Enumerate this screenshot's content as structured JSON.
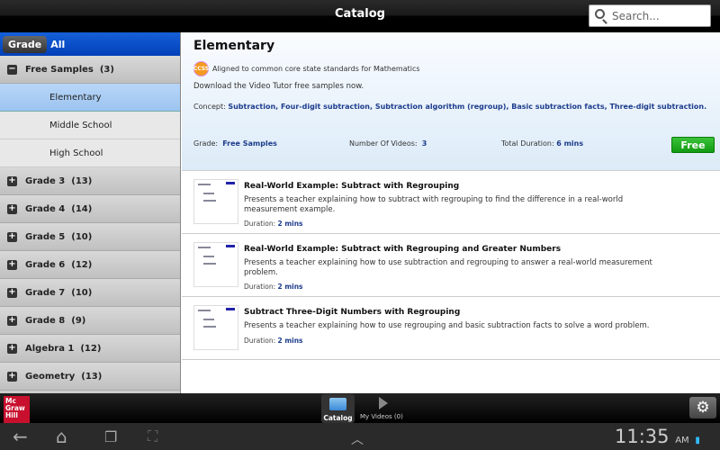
{
  "header": {
    "title": "Catalog",
    "search_placeholder": "Search..."
  },
  "sidebar": {
    "filter": {
      "button": "Grade",
      "value": "All"
    },
    "groups": [
      {
        "label": "Free Samples",
        "count": "(3)",
        "expanded": true,
        "children": [
          "Elementary",
          "Middle School",
          "High School"
        ],
        "selected": "Elementary"
      },
      {
        "label": "Grade 3",
        "count": "(13)"
      },
      {
        "label": "Grade 4",
        "count": "(14)"
      },
      {
        "label": "Grade 5",
        "count": "(10)"
      },
      {
        "label": "Grade 6",
        "count": "(12)"
      },
      {
        "label": "Grade 7",
        "count": "(10)"
      },
      {
        "label": "Grade 8",
        "count": "(9)"
      },
      {
        "label": "Algebra 1",
        "count": "(12)"
      },
      {
        "label": "Geometry",
        "count": "(13)"
      }
    ]
  },
  "detail": {
    "title": "Elementary",
    "ccss_badge": "CCSS",
    "ccss_text": "Aligned to common core state standards for Mathematics",
    "description": "Download the Video Tutor free samples now.",
    "concept_label": "Concept:",
    "concepts": "Subtraction, Four-digit subtraction, Subtraction algorithm (regroup), Basic subtraction facts, Three-digit subtraction.",
    "grade_label": "Grade:",
    "grade": "Free Samples",
    "videos_label": "Number Of Videos:",
    "videos": "3",
    "duration_label": "Total Duration:",
    "duration": "6 mins",
    "price_button": "Free"
  },
  "videos": [
    {
      "title": "Real-World Example: Subtract with Regrouping",
      "description": "Presents a teacher explaining how to subtract with regrouping to find the difference in a real-world measurement example.",
      "duration_label": "Duration:",
      "duration": "2 mins"
    },
    {
      "title": "Real-World Example: Subtract with Regrouping and Greater Numbers",
      "description": "Presents a teacher explaining how to use subtraction and regrouping to answer a real-world measurement problem.",
      "duration_label": "Duration:",
      "duration": "2 mins"
    },
    {
      "title": "Subtract Three-Digit Numbers with Regrouping",
      "description": "Presents a teacher explaining how to use regrouping and basic subtraction facts to solve a word problem.",
      "duration_label": "Duration:",
      "duration": "2 mins"
    }
  ],
  "appbar": {
    "logo": "Mc Graw Hill",
    "tabs": [
      {
        "label": "Catalog",
        "active": true
      },
      {
        "label": "My Videos (0)"
      }
    ]
  },
  "system": {
    "time": "11:35",
    "ampm": "AM"
  }
}
